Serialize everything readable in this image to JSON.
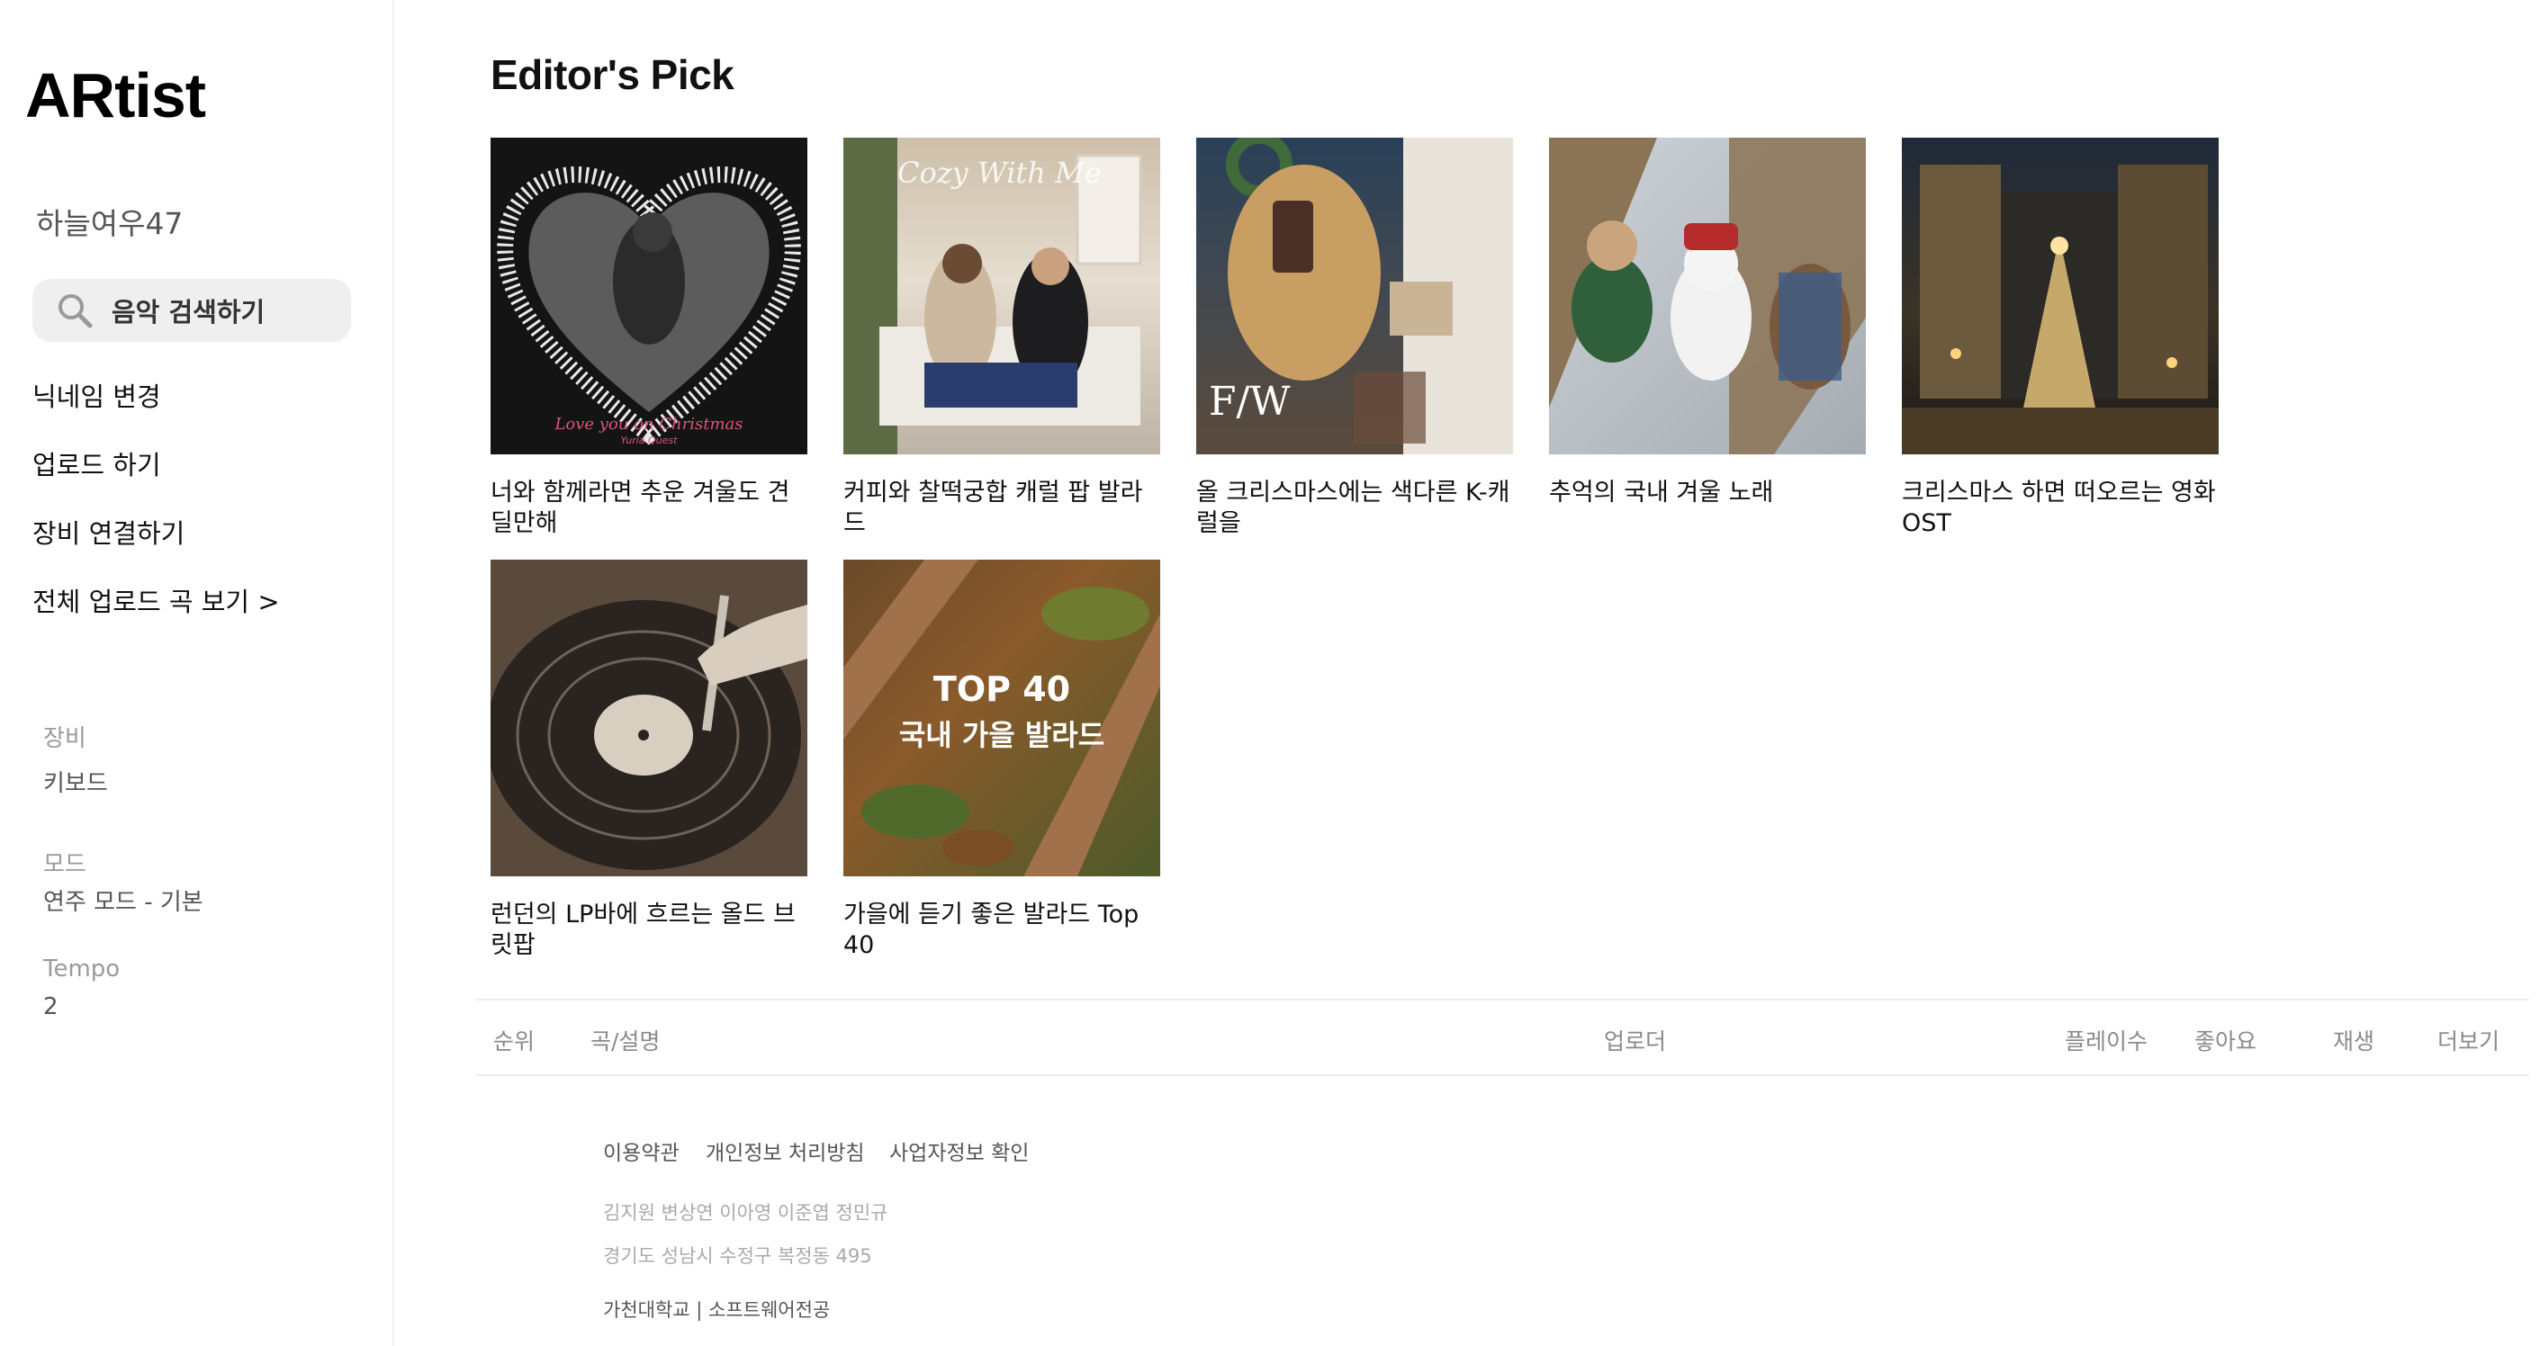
{
  "app": {
    "logo": "ARtist"
  },
  "sidebar": {
    "nickname": "하늘여우47",
    "search_label": "음악 검색하기",
    "menu": [
      "닉네임 변경",
      "업로드 하기",
      "장비 연결하기",
      "전체 업로드 곡 보기 >"
    ],
    "device_label": "장비",
    "device_value": "키보드",
    "mode_label": "모드",
    "mode_value": "연주 모드 - 기본",
    "tempo_label": "Tempo",
    "tempo_value": "2"
  },
  "editors_pick": {
    "title": "Editor's Pick",
    "cards": [
      {
        "title": "너와 함께라면 추운 겨울도 견딜만해",
        "cover_text": "Love you on Christmas",
        "cover_subtext": "Yuria Quest"
      },
      {
        "title": "커피와 찰떡궁합 캐럴 팝 발라드",
        "cover_text": "Cozy With Me"
      },
      {
        "title": "올 크리스마스에는 색다른 K-캐럴을",
        "cover_text": "F/W"
      },
      {
        "title": "추억의 국내 겨울 노래"
      },
      {
        "title": "크리스마스 하면 떠오르는 영화 OST"
      },
      {
        "title": "런던의 LP바에 흐르는 올드 브릿팝"
      },
      {
        "title": "가을에 듣기 좋은 발라드 Top 40",
        "cover_text": "TOP 40",
        "cover_subtext": "국내 가을 발라드"
      }
    ]
  },
  "table": {
    "headers": {
      "rank": "순위",
      "song": "곡/설명",
      "uploader": "업로더",
      "plays": "플레이수",
      "likes": "좋아요",
      "play": "재생",
      "more": "더보기"
    }
  },
  "footer": {
    "links": [
      "이용약관",
      "개인정보 처리방침",
      "사업자정보 확인"
    ],
    "members": "김지원 변상연 이아영 이준엽 정민규",
    "address": "경기도 성남시 수정구 복정동 495",
    "school": "가천대학교 | 소프트웨어전공"
  }
}
